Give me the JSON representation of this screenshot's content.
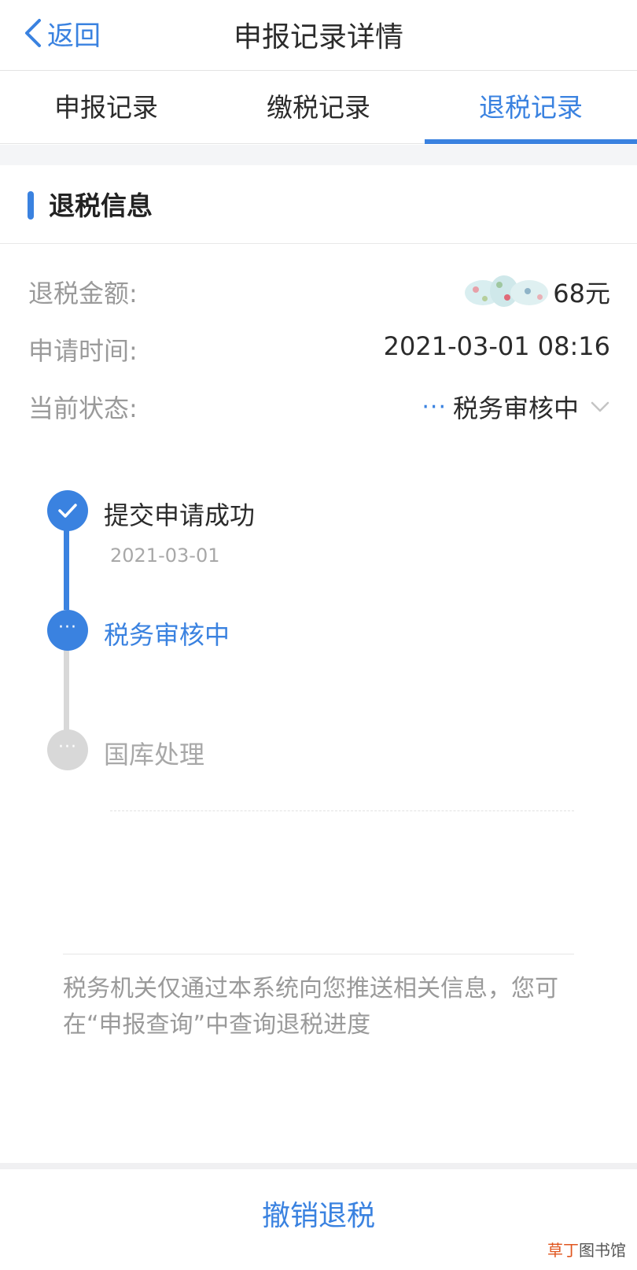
{
  "navbar": {
    "back_label": "返回",
    "title": "申报记录详情"
  },
  "tabs": [
    {
      "label": "申报记录",
      "active": false
    },
    {
      "label": "缴税记录",
      "active": false
    },
    {
      "label": "退税记录",
      "active": true
    }
  ],
  "section": {
    "title": "退税信息"
  },
  "info": {
    "amount_label": "退税金额:",
    "amount_value_visible": "68元",
    "time_label": "申请时间:",
    "time_value": "2021-03-01 08:16",
    "status_label": "当前状态:",
    "status_value": "税务审核中",
    "status_dots": "···"
  },
  "timeline": [
    {
      "title": "提交申请成功",
      "date": "2021-03-01",
      "state": "done"
    },
    {
      "title": "税务审核中",
      "state": "current"
    },
    {
      "title": "国库处理",
      "state": "pending"
    }
  ],
  "notice": "税务机关仅通过本系统向您推送相关信息，您可在“申报查询”中查询退税进度",
  "footer": {
    "revoke_label": "撤销退税"
  },
  "watermark": {
    "accent": "草丁",
    "rest": "图书馆"
  },
  "colors": {
    "accent": "#3a82e0",
    "muted": "#9a9a9a",
    "pending": "#d8d8d8"
  },
  "icons": {
    "back": "chevron-left-icon",
    "status_expand": "chevron-down-icon",
    "step_done": "check-icon",
    "step_current": "more-dots-icon",
    "step_pending": "more-dots-icon"
  }
}
